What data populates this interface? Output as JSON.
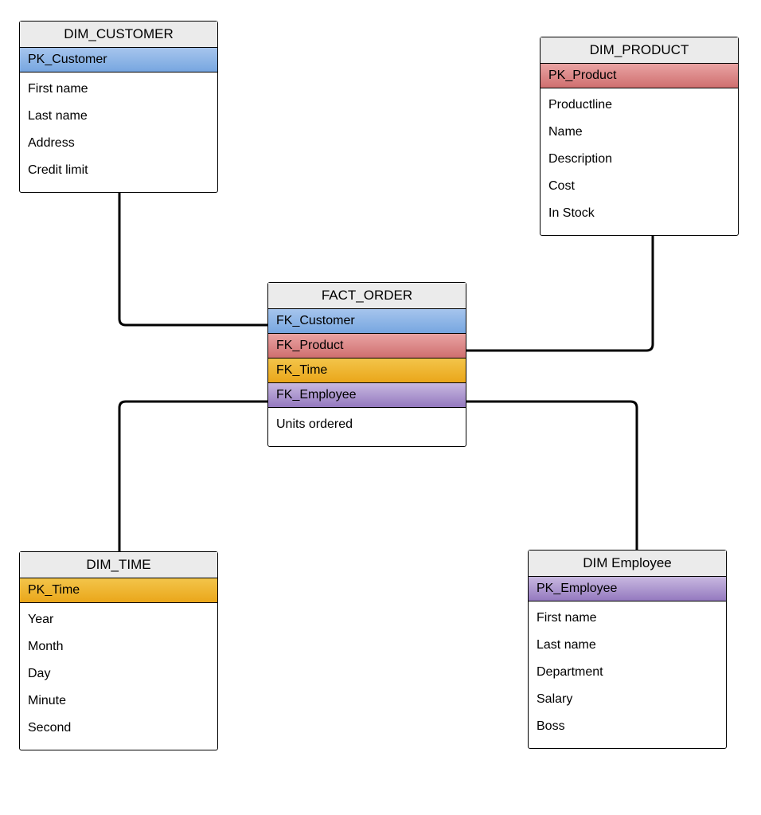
{
  "colors": {
    "blue_start": "#a6c5ed",
    "blue_end": "#77a6e0",
    "red_start": "#e9a3a3",
    "red_end": "#cf6f6f",
    "orange_start": "#f3c54a",
    "orange_end": "#eaa61a",
    "purple_start": "#c8b8e0",
    "purple_end": "#9479bf",
    "header_grey": "#ebebeb"
  },
  "entities": {
    "customer": {
      "title": "DIM_CUSTOMER",
      "pk": "PK_Customer",
      "attrs": [
        "First name",
        "Last name",
        "Address",
        "Credit limit"
      ]
    },
    "product": {
      "title": "DIM_PRODUCT",
      "pk": "PK_Product",
      "attrs": [
        "Productline",
        "Name",
        "Description",
        "Cost",
        "In Stock"
      ]
    },
    "fact": {
      "title": "FACT_ORDER",
      "fks": {
        "customer": "FK_Customer",
        "product": "FK_Product",
        "time": "FK_Time",
        "employee": "FK_Employee"
      },
      "attrs": [
        "Units ordered"
      ]
    },
    "time": {
      "title": "DIM_TIME",
      "pk": "PK_Time",
      "attrs": [
        "Year",
        "Month",
        "Day",
        "Minute",
        "Second"
      ]
    },
    "employee": {
      "title": "DIM Employee",
      "pk": "PK_Employee",
      "attrs": [
        "First name",
        "Last name",
        "Department",
        "Salary",
        "Boss"
      ]
    }
  }
}
